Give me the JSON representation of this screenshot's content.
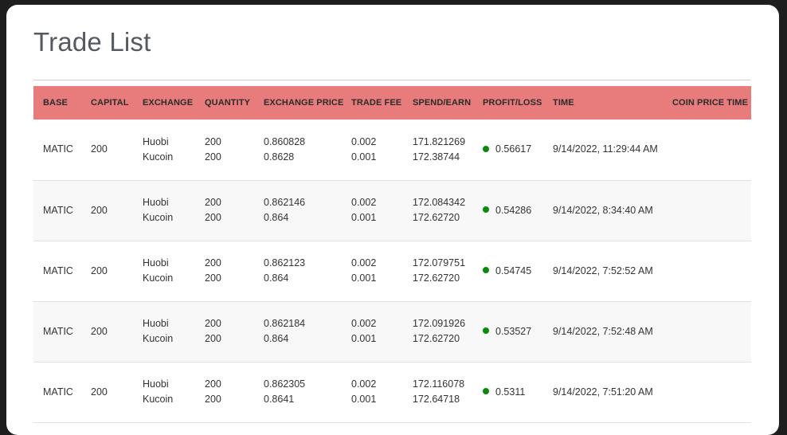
{
  "page": {
    "title": "Trade List"
  },
  "colors": {
    "header_bg": "#e87b7b",
    "profit_dot": "#0a8a0a"
  },
  "table": {
    "headers": [
      "BASE",
      "CAPITAL",
      "EXCHANGE",
      "QUANTITY",
      "EXCHANGE PRICE",
      "TRADE FEE",
      "SPEND/EARN",
      "PROFIT/LOSS",
      "TIME",
      "COIN PRICE TIME"
    ],
    "rows": [
      {
        "base": "MATIC",
        "capital": "200",
        "exchange": [
          "Huobi",
          "Kucoin"
        ],
        "quantity": [
          "200",
          "200"
        ],
        "price": [
          "0.860828",
          "0.8628"
        ],
        "fee": [
          "0.002",
          "0.001"
        ],
        "spend_earn": [
          "171.821269",
          "172.38744"
        ],
        "profit": "0.56617",
        "time": "9/14/2022, 11:29:44 AM",
        "coin_price_time": ""
      },
      {
        "base": "MATIC",
        "capital": "200",
        "exchange": [
          "Huobi",
          "Kucoin"
        ],
        "quantity": [
          "200",
          "200"
        ],
        "price": [
          "0.862146",
          "0.864"
        ],
        "fee": [
          "0.002",
          "0.001"
        ],
        "spend_earn": [
          "172.084342",
          "172.62720"
        ],
        "profit": "0.54286",
        "time": "9/14/2022, 8:34:40 AM",
        "coin_price_time": ""
      },
      {
        "base": "MATIC",
        "capital": "200",
        "exchange": [
          "Huobi",
          "Kucoin"
        ],
        "quantity": [
          "200",
          "200"
        ],
        "price": [
          "0.862123",
          "0.864"
        ],
        "fee": [
          "0.002",
          "0.001"
        ],
        "spend_earn": [
          "172.079751",
          "172.62720"
        ],
        "profit": "0.54745",
        "time": "9/14/2022, 7:52:52 AM",
        "coin_price_time": ""
      },
      {
        "base": "MATIC",
        "capital": "200",
        "exchange": [
          "Huobi",
          "Kucoin"
        ],
        "quantity": [
          "200",
          "200"
        ],
        "price": [
          "0.862184",
          "0.864"
        ],
        "fee": [
          "0.002",
          "0.001"
        ],
        "spend_earn": [
          "172.091926",
          "172.62720"
        ],
        "profit": "0.53527",
        "time": "9/14/2022, 7:52:48 AM",
        "coin_price_time": ""
      },
      {
        "base": "MATIC",
        "capital": "200",
        "exchange": [
          "Huobi",
          "Kucoin"
        ],
        "quantity": [
          "200",
          "200"
        ],
        "price": [
          "0.862305",
          "0.8641"
        ],
        "fee": [
          "0.002",
          "0.001"
        ],
        "spend_earn": [
          "172.116078",
          "172.64718"
        ],
        "profit": "0.5311",
        "time": "9/14/2022, 7:51:20 AM",
        "coin_price_time": ""
      }
    ]
  }
}
